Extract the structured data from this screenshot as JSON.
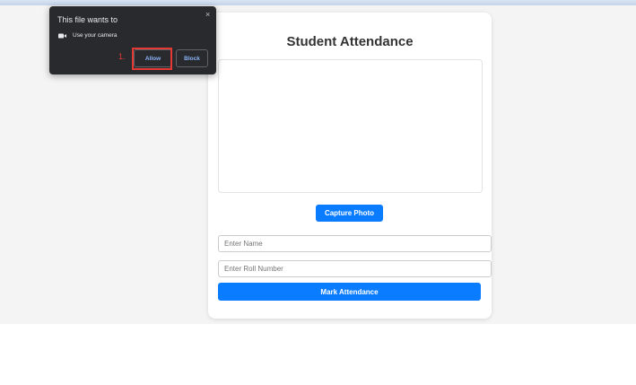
{
  "page": {
    "title": "Student Attendance",
    "capture_button": "Capture Photo",
    "name_placeholder": "Enter Name",
    "roll_placeholder": "Enter Roll Number",
    "mark_button": "Mark Attendance"
  },
  "permission_popup": {
    "title": "This file wants to",
    "permission": "Use your camera",
    "allow_label": "Allow",
    "block_label": "Block",
    "close_glyph": "×",
    "permission_icon": "video-camera-icon"
  },
  "annotation": {
    "step_label": "1."
  },
  "colors": {
    "primary_button": "#0a7cff",
    "popup_background": "#292a2d",
    "popup_link": "#8ab4f8",
    "highlight": "#e53935"
  }
}
